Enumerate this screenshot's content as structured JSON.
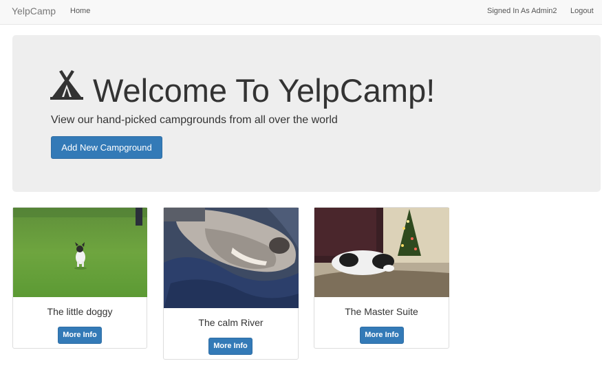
{
  "navbar": {
    "brand": "YelpCamp",
    "home": "Home",
    "signed_in": "Signed In As Admin2",
    "logout": "Logout"
  },
  "jumbotron": {
    "icon": "tent-icon",
    "title": "Welcome To YelpCamp!",
    "subtitle": "View our hand-picked campgrounds from all over the world",
    "add_button": "Add New Campground"
  },
  "campgrounds": [
    {
      "name": "The little doggy",
      "button": "More Info",
      "image": "small dog running on grass"
    },
    {
      "name": "The calm River",
      "button": "More Info",
      "image": "dog snout close-up on blue blanket"
    },
    {
      "name": "The Master Suite",
      "button": "More Info",
      "image": "dog lying on bed by christmas tree"
    }
  ],
  "colors": {
    "primary": "#337ab7",
    "navbar_bg": "#f8f8f8",
    "jumbotron_bg": "#eeeeee"
  }
}
